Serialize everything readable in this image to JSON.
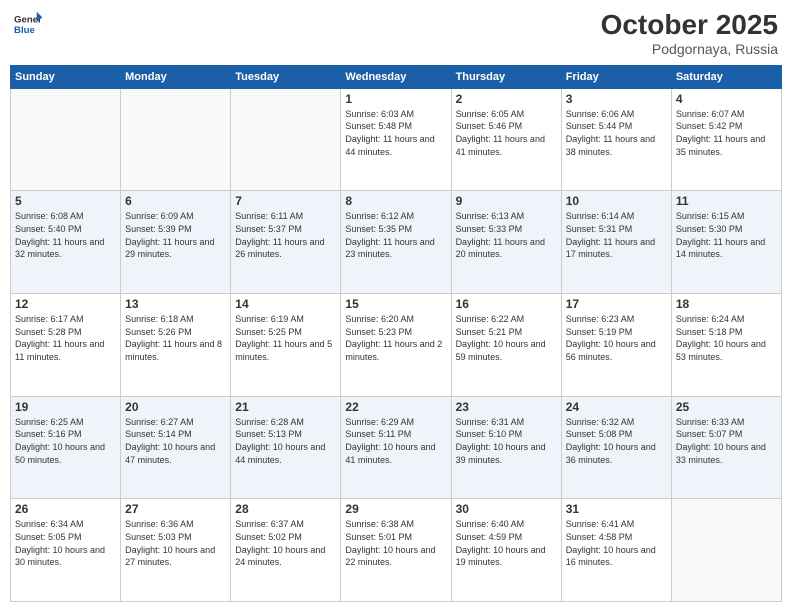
{
  "logo": {
    "general": "General",
    "blue": "Blue"
  },
  "title": "October 2025",
  "location": "Podgornaya, Russia",
  "weekdays": [
    "Sunday",
    "Monday",
    "Tuesday",
    "Wednesday",
    "Thursday",
    "Friday",
    "Saturday"
  ],
  "weeks": [
    [
      {
        "day": "",
        "info": ""
      },
      {
        "day": "",
        "info": ""
      },
      {
        "day": "",
        "info": ""
      },
      {
        "day": "1",
        "info": "Sunrise: 6:03 AM\nSunset: 5:48 PM\nDaylight: 11 hours and 44 minutes."
      },
      {
        "day": "2",
        "info": "Sunrise: 6:05 AM\nSunset: 5:46 PM\nDaylight: 11 hours and 41 minutes."
      },
      {
        "day": "3",
        "info": "Sunrise: 6:06 AM\nSunset: 5:44 PM\nDaylight: 11 hours and 38 minutes."
      },
      {
        "day": "4",
        "info": "Sunrise: 6:07 AM\nSunset: 5:42 PM\nDaylight: 11 hours and 35 minutes."
      }
    ],
    [
      {
        "day": "5",
        "info": "Sunrise: 6:08 AM\nSunset: 5:40 PM\nDaylight: 11 hours and 32 minutes."
      },
      {
        "day": "6",
        "info": "Sunrise: 6:09 AM\nSunset: 5:39 PM\nDaylight: 11 hours and 29 minutes."
      },
      {
        "day": "7",
        "info": "Sunrise: 6:11 AM\nSunset: 5:37 PM\nDaylight: 11 hours and 26 minutes."
      },
      {
        "day": "8",
        "info": "Sunrise: 6:12 AM\nSunset: 5:35 PM\nDaylight: 11 hours and 23 minutes."
      },
      {
        "day": "9",
        "info": "Sunrise: 6:13 AM\nSunset: 5:33 PM\nDaylight: 11 hours and 20 minutes."
      },
      {
        "day": "10",
        "info": "Sunrise: 6:14 AM\nSunset: 5:31 PM\nDaylight: 11 hours and 17 minutes."
      },
      {
        "day": "11",
        "info": "Sunrise: 6:15 AM\nSunset: 5:30 PM\nDaylight: 11 hours and 14 minutes."
      }
    ],
    [
      {
        "day": "12",
        "info": "Sunrise: 6:17 AM\nSunset: 5:28 PM\nDaylight: 11 hours and 11 minutes."
      },
      {
        "day": "13",
        "info": "Sunrise: 6:18 AM\nSunset: 5:26 PM\nDaylight: 11 hours and 8 minutes."
      },
      {
        "day": "14",
        "info": "Sunrise: 6:19 AM\nSunset: 5:25 PM\nDaylight: 11 hours and 5 minutes."
      },
      {
        "day": "15",
        "info": "Sunrise: 6:20 AM\nSunset: 5:23 PM\nDaylight: 11 hours and 2 minutes."
      },
      {
        "day": "16",
        "info": "Sunrise: 6:22 AM\nSunset: 5:21 PM\nDaylight: 10 hours and 59 minutes."
      },
      {
        "day": "17",
        "info": "Sunrise: 6:23 AM\nSunset: 5:19 PM\nDaylight: 10 hours and 56 minutes."
      },
      {
        "day": "18",
        "info": "Sunrise: 6:24 AM\nSunset: 5:18 PM\nDaylight: 10 hours and 53 minutes."
      }
    ],
    [
      {
        "day": "19",
        "info": "Sunrise: 6:25 AM\nSunset: 5:16 PM\nDaylight: 10 hours and 50 minutes."
      },
      {
        "day": "20",
        "info": "Sunrise: 6:27 AM\nSunset: 5:14 PM\nDaylight: 10 hours and 47 minutes."
      },
      {
        "day": "21",
        "info": "Sunrise: 6:28 AM\nSunset: 5:13 PM\nDaylight: 10 hours and 44 minutes."
      },
      {
        "day": "22",
        "info": "Sunrise: 6:29 AM\nSunset: 5:11 PM\nDaylight: 10 hours and 41 minutes."
      },
      {
        "day": "23",
        "info": "Sunrise: 6:31 AM\nSunset: 5:10 PM\nDaylight: 10 hours and 39 minutes."
      },
      {
        "day": "24",
        "info": "Sunrise: 6:32 AM\nSunset: 5:08 PM\nDaylight: 10 hours and 36 minutes."
      },
      {
        "day": "25",
        "info": "Sunrise: 6:33 AM\nSunset: 5:07 PM\nDaylight: 10 hours and 33 minutes."
      }
    ],
    [
      {
        "day": "26",
        "info": "Sunrise: 6:34 AM\nSunset: 5:05 PM\nDaylight: 10 hours and 30 minutes."
      },
      {
        "day": "27",
        "info": "Sunrise: 6:36 AM\nSunset: 5:03 PM\nDaylight: 10 hours and 27 minutes."
      },
      {
        "day": "28",
        "info": "Sunrise: 6:37 AM\nSunset: 5:02 PM\nDaylight: 10 hours and 24 minutes."
      },
      {
        "day": "29",
        "info": "Sunrise: 6:38 AM\nSunset: 5:01 PM\nDaylight: 10 hours and 22 minutes."
      },
      {
        "day": "30",
        "info": "Sunrise: 6:40 AM\nSunset: 4:59 PM\nDaylight: 10 hours and 19 minutes."
      },
      {
        "day": "31",
        "info": "Sunrise: 6:41 AM\nSunset: 4:58 PM\nDaylight: 10 hours and 16 minutes."
      },
      {
        "day": "",
        "info": ""
      }
    ]
  ]
}
